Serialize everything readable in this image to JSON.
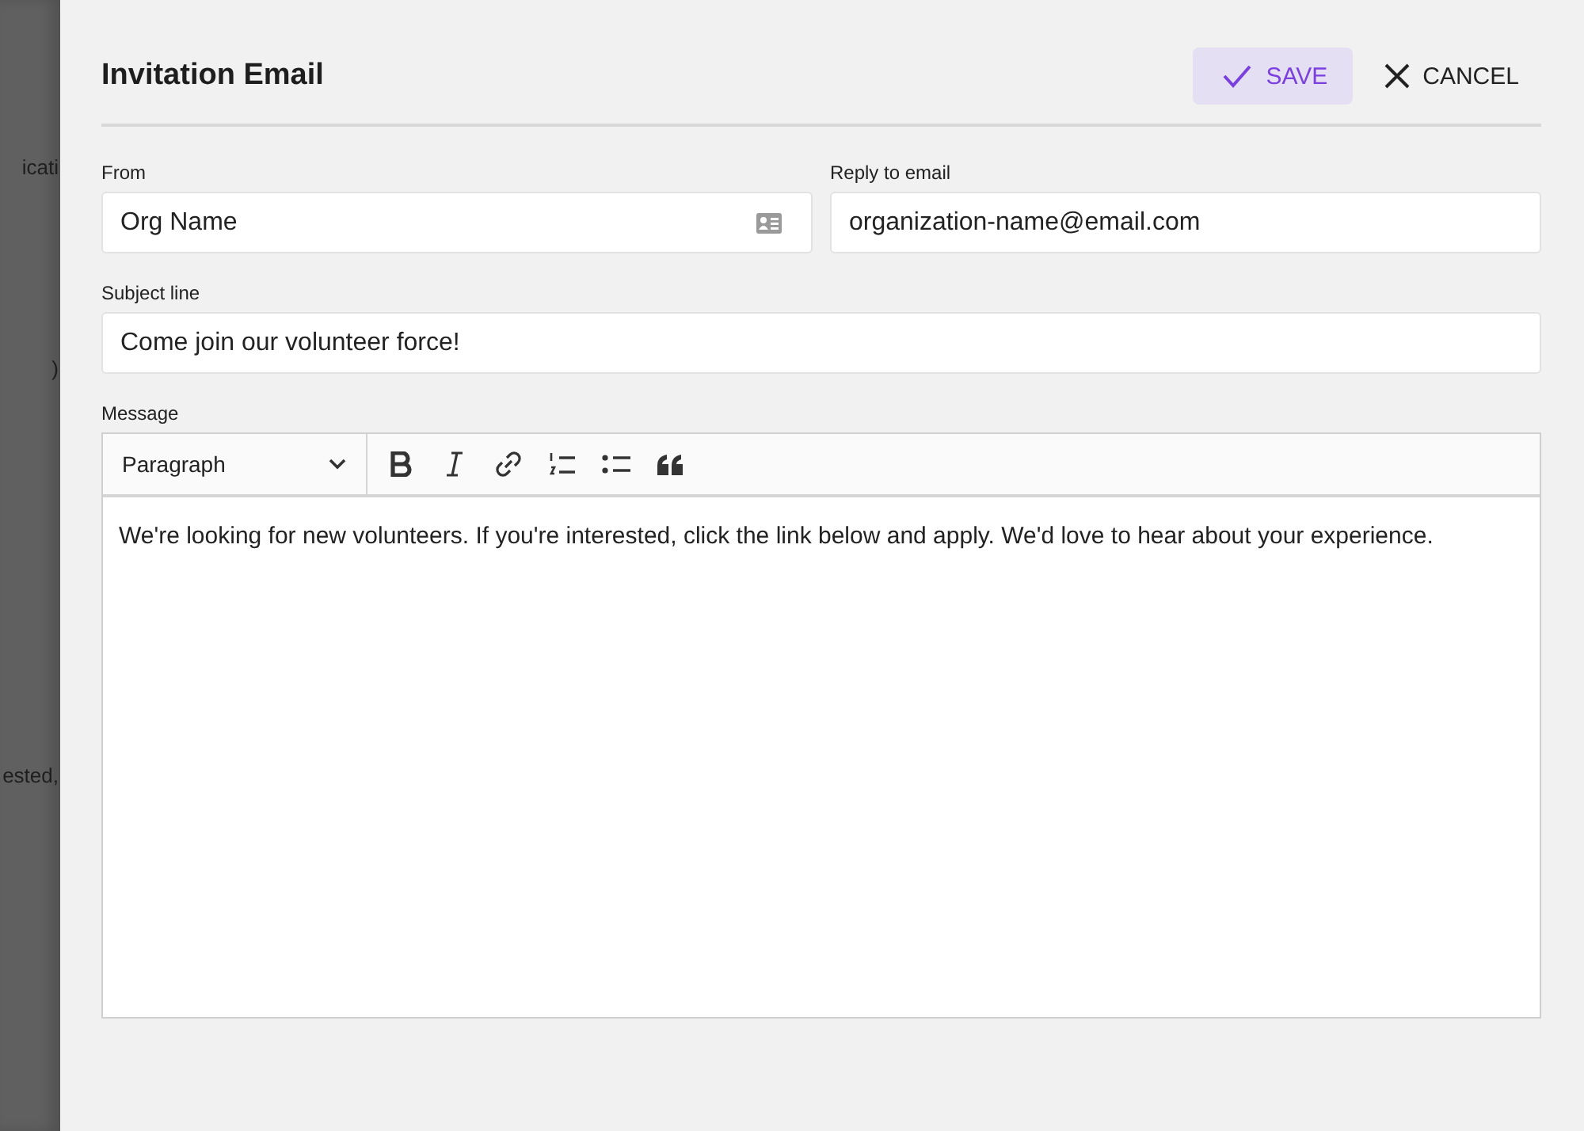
{
  "background_page": {
    "texts": [
      "icati",
      ")",
      "ested,"
    ]
  },
  "dialog": {
    "title": "Invitation Email",
    "buttons": [
      {
        "kind": "save",
        "label": "SAVE"
      },
      {
        "kind": "cancel",
        "label": "CANCEL"
      }
    ],
    "from": {
      "label": "From",
      "value": "Org Name"
    },
    "reply_to": {
      "label": "Reply to email",
      "value": "organization-name@email.com"
    },
    "subject": {
      "label": "Subject line",
      "value": "Come join our volunteer force!"
    },
    "message": {
      "label": "Message",
      "format": "Paragraph",
      "tools": [
        {
          "kind": "bold"
        },
        {
          "kind": "italic"
        },
        {
          "kind": "link"
        },
        {
          "kind": "numbered"
        },
        {
          "kind": "bulleted"
        },
        {
          "kind": "quote"
        }
      ],
      "body": "We're looking for new volunteers. If you're interested, click the link below and apply. We'd love to hear about your experience."
    }
  }
}
